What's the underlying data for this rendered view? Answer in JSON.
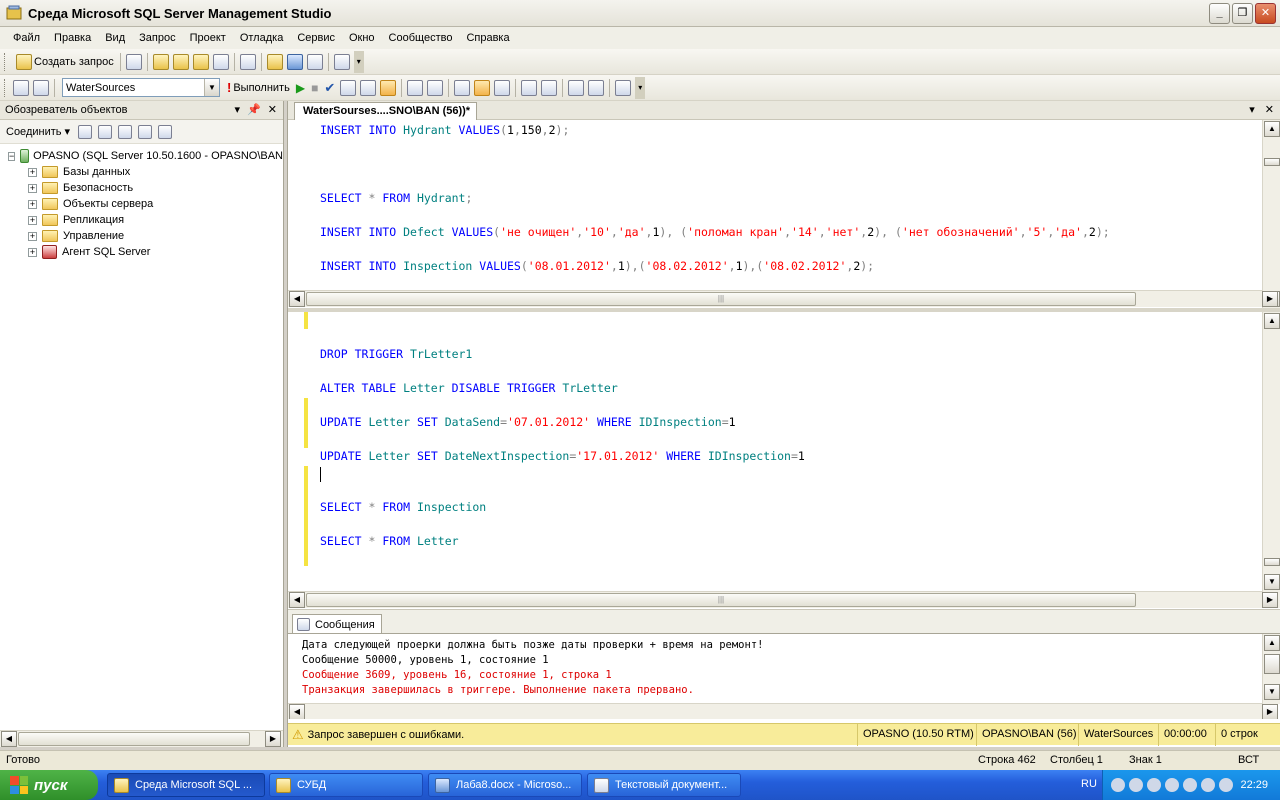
{
  "window": {
    "title": "Среда Microsoft SQL Server Management Studio"
  },
  "menu": [
    "Файл",
    "Правка",
    "Вид",
    "Запрос",
    "Проект",
    "Отладка",
    "Сервис",
    "Окно",
    "Сообщество",
    "Справка"
  ],
  "toolbar": {
    "new_query_label": "Создать запрос",
    "database": "WaterSources",
    "execute_label": "Выполнить"
  },
  "object_explorer": {
    "title": "Обозреватель объектов",
    "connect_label": "Соединить",
    "server": "OPASNO (SQL Server 10.50.1600 - OPASNO\\BAN",
    "nodes": [
      "Базы данных",
      "Безопасность",
      "Объекты сервера",
      "Репликация",
      "Управление",
      "Агент SQL Server"
    ]
  },
  "editor": {
    "tab_title": "WaterSourses....SNO\\BAN (56))*"
  },
  "messages": {
    "tab_label": "Сообщения",
    "lines": [
      "Дата следующей проерки должна быть позже даты проверки + время на ремонт!",
      "Сообщение 50000, уровень 1, состояние 1",
      "Сообщение 3609, уровень 16, состояние 1, строка 1",
      "Транзакция завершилась в триггере. Выполнение пакета прервано."
    ]
  },
  "query_status": {
    "message": "Запрос завершен с ошибками.",
    "server": "OPASNO (10.50 RTM)",
    "user": "OPASNO\\BAN (56)",
    "database": "WaterSources",
    "elapsed": "00:00:00",
    "rows": "0 строк"
  },
  "status_bar": {
    "ready": "Готово",
    "line": "Строка 462",
    "column": "Столбец 1",
    "char": "Знак 1",
    "mode": "ВСТ"
  },
  "taskbar": {
    "start_label": "пуск",
    "tasks": [
      "Среда Microsoft SQL ...",
      "СУБД",
      "Лаба8.docx - Microso...",
      "Текстовый документ..."
    ],
    "language": "RU",
    "clock": "22:29"
  },
  "colors": {
    "keyword": "#0000ff",
    "identifier": "#008080",
    "string": "#ff0000",
    "error": "#dd0000",
    "status_yellow": "#f8ec9a"
  }
}
